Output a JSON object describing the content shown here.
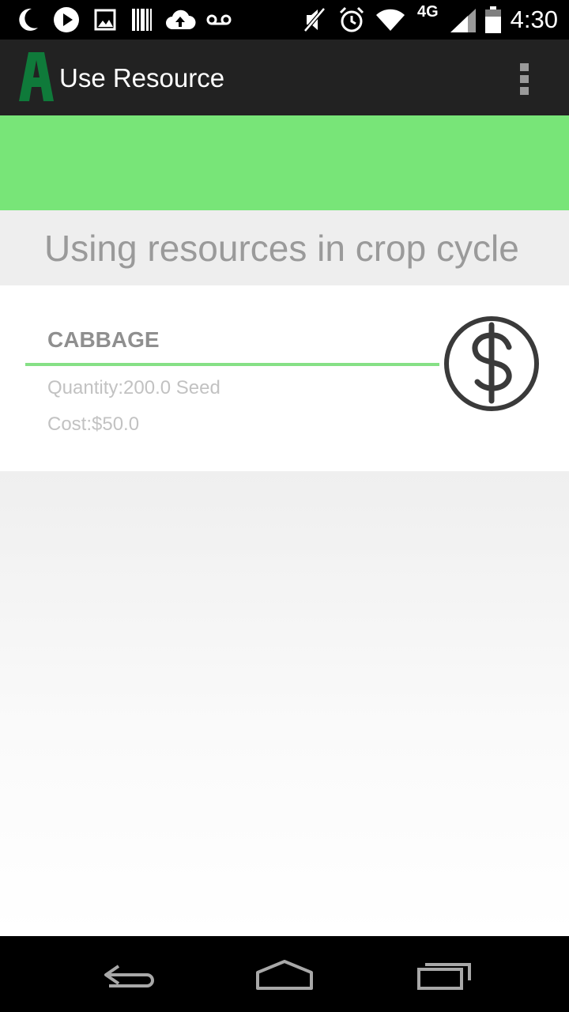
{
  "status_bar": {
    "time": "4:30",
    "network": "4G",
    "icons": [
      "moon-icon",
      "play-icon",
      "image-icon",
      "barcode-icon",
      "cloud-upload-icon",
      "voicemail-icon",
      "mute-icon",
      "alarm-icon",
      "wifi-icon",
      "signal-icon",
      "battery-icon"
    ]
  },
  "action_bar": {
    "logo_letter": "A",
    "title": "Use Resource",
    "overflow_icon": "overflow-menu-icon"
  },
  "colors": {
    "banner": "#78e578",
    "action_bar": "#222222",
    "logo": "#0f7a3a",
    "divider": "#86e086"
  },
  "section": {
    "header": "Using resources in crop cycle"
  },
  "resource": {
    "name": "CABBAGE",
    "quantity": "Quantity:200.0 Seed",
    "cost": "Cost:$50.0",
    "icon": "dollar-icon"
  },
  "nav_bar": {
    "buttons": [
      "back-icon",
      "home-icon",
      "recents-icon"
    ]
  }
}
